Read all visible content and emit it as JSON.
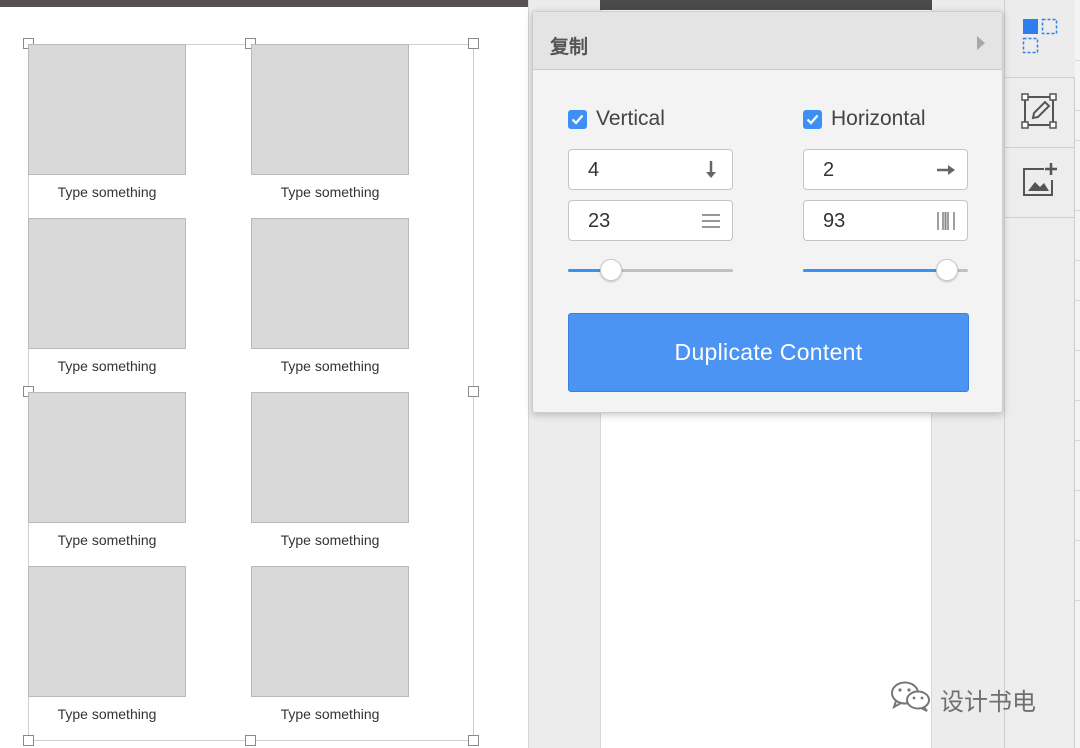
{
  "canvas": {
    "cards": [
      {
        "caption": "Type something"
      },
      {
        "caption": "Type something"
      },
      {
        "caption": "Type something"
      },
      {
        "caption": "Type something"
      },
      {
        "caption": "Type something"
      },
      {
        "caption": "Type something"
      },
      {
        "caption": "Type something"
      },
      {
        "caption": "Type something"
      }
    ]
  },
  "panel": {
    "title": "复制",
    "vertical": {
      "label": "Vertical",
      "checked": true,
      "count": "4",
      "spacing": "23",
      "count_icon": "arrow-down-icon",
      "spacing_icon": "horizontal-lines-icon",
      "slider_fraction": 0.26
    },
    "horizontal": {
      "label": "Horizontal",
      "checked": true,
      "count": "2",
      "spacing": "93",
      "count_icon": "arrow-right-icon",
      "spacing_icon": "vertical-lines-icon",
      "slider_fraction": 0.87
    },
    "button_label": "Duplicate Content"
  },
  "toolbar": {
    "tools": [
      "duplicate-grid-icon",
      "edit-shape-icon",
      "add-image-icon"
    ]
  },
  "watermark": {
    "text": "设计书电"
  },
  "colors": {
    "accent": "#4b94f3",
    "card_fill": "#d9d9d9"
  }
}
